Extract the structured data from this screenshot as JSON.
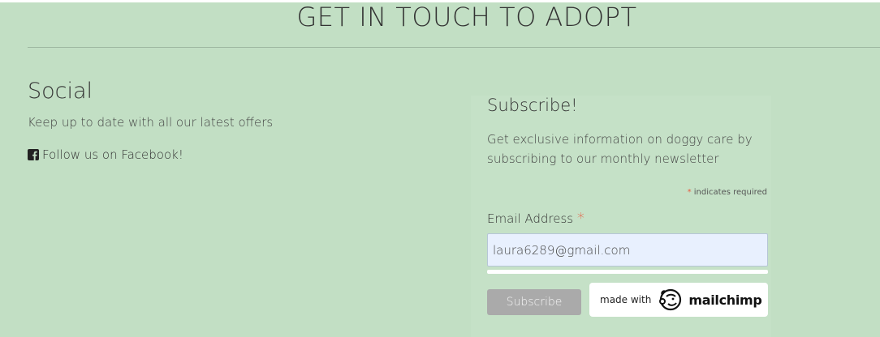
{
  "header": {
    "title": "GET IN TOUCH TO ADOPT"
  },
  "social": {
    "heading": "Social",
    "text": "Keep up to date with all our latest offers",
    "facebook_link": "Follow us on Facebook!",
    "facebook_icon": "facebook-square-icon"
  },
  "subscribe": {
    "heading": "Subscribe!",
    "description": "Get exclusive information on doggy care by subscribing to our monthly newsletter",
    "required_star": "*",
    "required_note": "indicates required",
    "email_label": "Email Address",
    "email_value": "laura6289@gmail.com",
    "button_label": "Subscribe",
    "badge_prefix": "made with",
    "badge_brand": "mailchimp",
    "badge_icon": "mailchimp-freddie-icon"
  },
  "colors": {
    "background": "#c2dfc4",
    "input_fill": "#e8f0fe",
    "button": "#aaaaaa",
    "required_star": "#e85c41"
  }
}
